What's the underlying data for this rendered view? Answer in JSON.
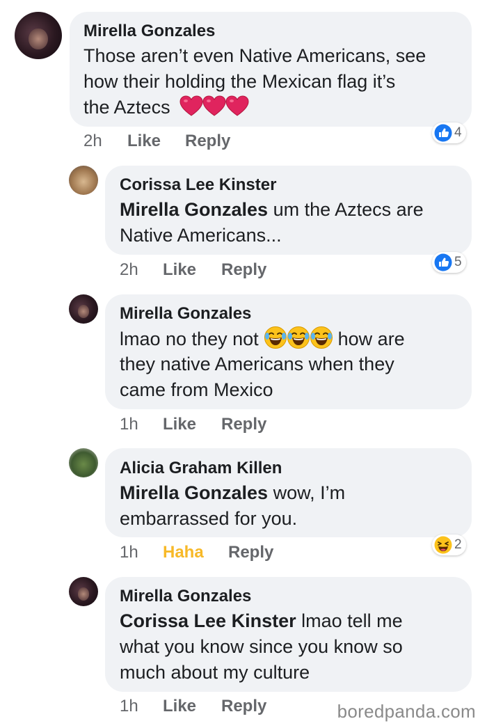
{
  "comments": [
    {
      "author": "Mirella Gonzales",
      "lines": [
        "Those aren’t even Native Americans, see",
        "how their holding the Mexican flag it’s",
        "the Aztecs"
      ],
      "emoji": "heart-emoji",
      "time": "2h",
      "like": "Like",
      "reply": "Reply",
      "reaction": {
        "icon": "like-icon",
        "count": "4"
      }
    },
    {
      "author": "Corissa Lee Kinster",
      "mention": "Mirella Gonzales",
      "lines": [
        " um the Aztecs are",
        "Native Americans..."
      ],
      "time": "2h",
      "like": "Like",
      "reply": "Reply",
      "reaction": {
        "icon": "like-icon",
        "count": "5"
      }
    },
    {
      "author": "Mirella Gonzales",
      "lines": [
        "lmao no they not ",
        " how are",
        "they native Americans when they",
        "came from Mexico"
      ],
      "emoji": "laughing-emoji",
      "time": "1h",
      "like": "Like",
      "reply": "Reply"
    },
    {
      "author": "Alicia Graham Killen",
      "mention": "Mirella Gonzales",
      "lines": [
        " wow, I’m",
        "embarrassed for you."
      ],
      "time": "1h",
      "like": "Haha",
      "reply": "Reply",
      "reaction": {
        "icon": "haha-icon",
        "count": "2"
      }
    },
    {
      "author": "Mirella Gonzales",
      "mention": "Corissa Lee Kinster",
      "lines": [
        " lmao tell me",
        "what you know since you know so",
        "much about my culture"
      ],
      "time": "1h",
      "like": "Like",
      "reply": "Reply"
    }
  ],
  "watermark": "boredpanda.com",
  "colors": {
    "bubble": "#f0f2f5",
    "meta": "#65676b",
    "haha": "#f7b928",
    "like_blue": "#1877f2",
    "heart": "#e0245e"
  }
}
